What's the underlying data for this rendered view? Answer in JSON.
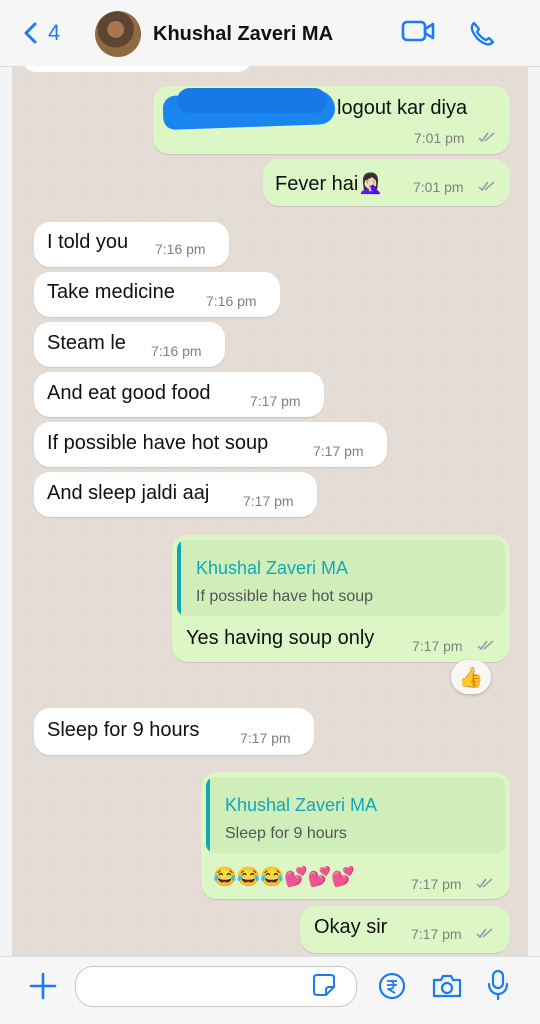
{
  "header": {
    "back_count": "4",
    "contact_name": "Khushal Zaveri MA",
    "icons": [
      "chevron-left-icon",
      "video-camera-icon",
      "phone-icon"
    ]
  },
  "messages": [
    {
      "type": "out",
      "text": "logout kar diya",
      "time": "7:01 pm",
      "status": "read"
    },
    {
      "type": "out",
      "text": "Fever hai🤦🏻‍♀️",
      "time": "7:01 pm",
      "status": "read"
    },
    {
      "type": "in",
      "text": "I told you",
      "time": "7:16 pm"
    },
    {
      "type": "in",
      "text": "Take medicine",
      "time": "7:16 pm"
    },
    {
      "type": "in",
      "text": "Steam le",
      "time": "7:16 pm"
    },
    {
      "type": "in",
      "text": "And eat good food",
      "time": "7:17 pm"
    },
    {
      "type": "in",
      "text": "If possible have hot soup",
      "time": "7:17 pm"
    },
    {
      "type": "in",
      "text": "And sleep jaldi aaj",
      "time": "7:17 pm"
    },
    {
      "type": "out",
      "quote_name": "Khushal Zaveri MA",
      "quote_text": "If possible have hot soup",
      "text": "Yes having soup only",
      "time": "7:17 pm",
      "status": "read",
      "reaction": "👍"
    },
    {
      "type": "in",
      "text": "Sleep for  9 hours",
      "time": "7:17 pm"
    },
    {
      "type": "out",
      "quote_name": "Khushal Zaveri MA",
      "quote_text": "Sleep for  9 hours",
      "text": "😂😂😂💕💕💕",
      "time": "7:17 pm",
      "status": "read"
    },
    {
      "type": "out",
      "text": "Okay sir",
      "time": "7:17 pm",
      "status": "read"
    }
  ],
  "input_bar": {
    "message_value": "",
    "icons": [
      "plus-icon",
      "sticker-icon",
      "rupee-payment-icon",
      "camera-icon",
      "microphone-icon"
    ]
  },
  "colors": {
    "accent": "#1a7cf5",
    "incoming_bubble": "#ffffff",
    "outgoing_bubble": "#dcf7c5",
    "quote_name": "#13a7b6",
    "chat_background": "#e5ddd5"
  }
}
